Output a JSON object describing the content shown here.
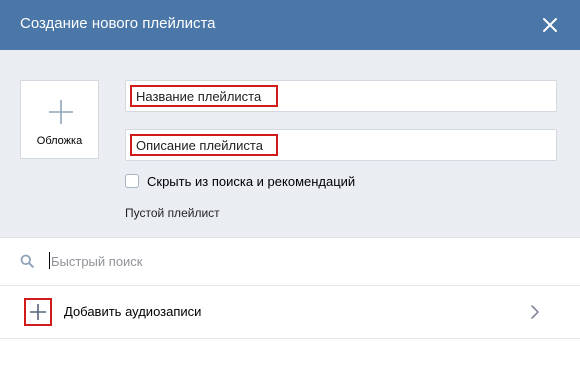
{
  "header": {
    "title": "Создание нового плейлиста",
    "close_icon": "close-icon"
  },
  "cover": {
    "label": "Обложка",
    "icon": "plus-icon"
  },
  "form": {
    "name_placeholder": "Название плейлиста",
    "description_placeholder": "Описание плейлиста",
    "hide_checkbox_label": "Скрыть из поиска и рекомендаций",
    "hide_checked": false,
    "empty_text": "Пустой плейлист"
  },
  "search": {
    "placeholder": "Быстрый поиск",
    "icon": "search-icon"
  },
  "add_audio": {
    "label": "Добавить аудиозаписи",
    "icon": "plus-icon",
    "chevron_icon": "chevron-right-icon"
  },
  "colors": {
    "header_bg": "#4a76a8",
    "panel_bg": "#eaedf2",
    "highlight_border": "#d11a1a"
  }
}
